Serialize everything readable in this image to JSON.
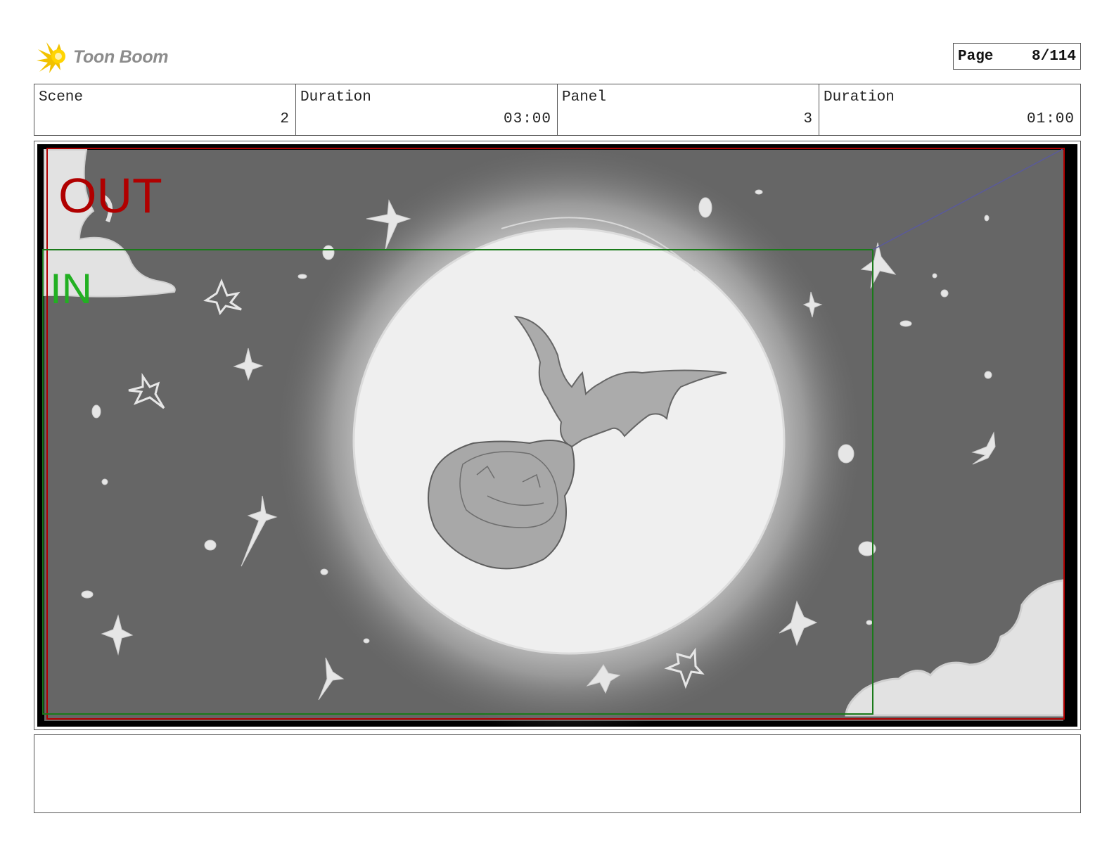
{
  "header": {
    "logo_text": "Toon Boom",
    "page_label": "Page",
    "page_value": "8/114"
  },
  "info": {
    "scene_label": "Scene",
    "scene_value": "2",
    "scene_duration_label": "Duration",
    "scene_duration_value": "03:00",
    "panel_label": "Panel",
    "panel_value": "3",
    "panel_duration_label": "Duration",
    "panel_duration_value": "01:00"
  },
  "panel": {
    "out_label": "OUT",
    "in_label": "IN"
  },
  "caption": {
    "text": ""
  },
  "colors": {
    "out_frame": "#b00000",
    "in_frame": "#1a7a1a",
    "in_text": "#22b022",
    "sky": "#666666",
    "moon": "#efefef"
  }
}
